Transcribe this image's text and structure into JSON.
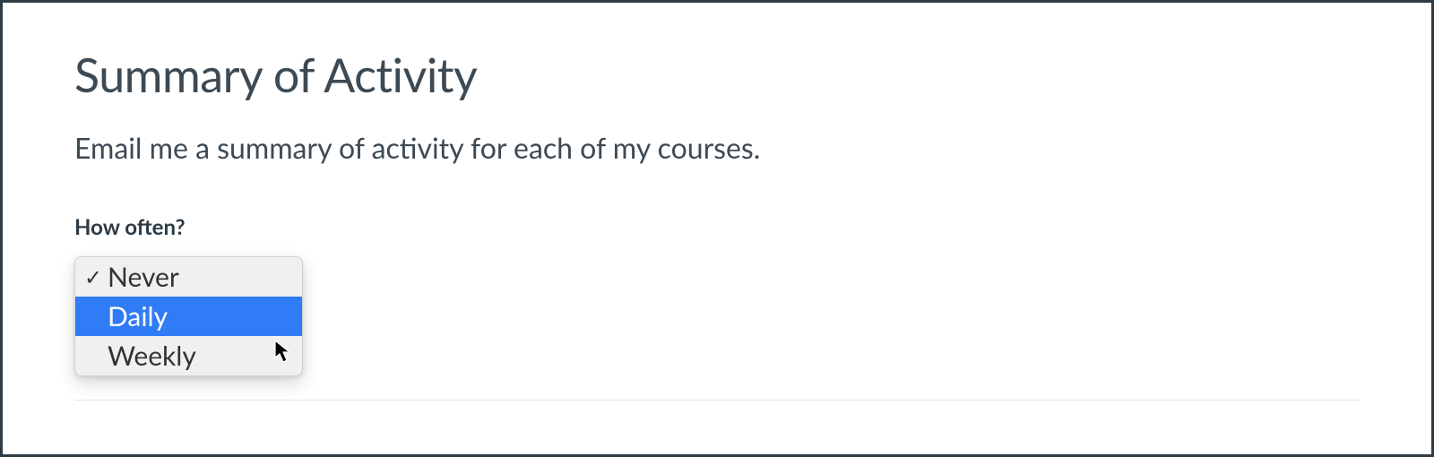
{
  "heading": "Summary of Activity",
  "description": "Email me a summary of activity for each of my courses.",
  "field_label": "How often?",
  "dropdown": {
    "options": [
      {
        "label": "Never",
        "selected": true,
        "highlighted": false
      },
      {
        "label": "Daily",
        "selected": false,
        "highlighted": true
      },
      {
        "label": "Weekly",
        "selected": false,
        "highlighted": false
      }
    ]
  }
}
